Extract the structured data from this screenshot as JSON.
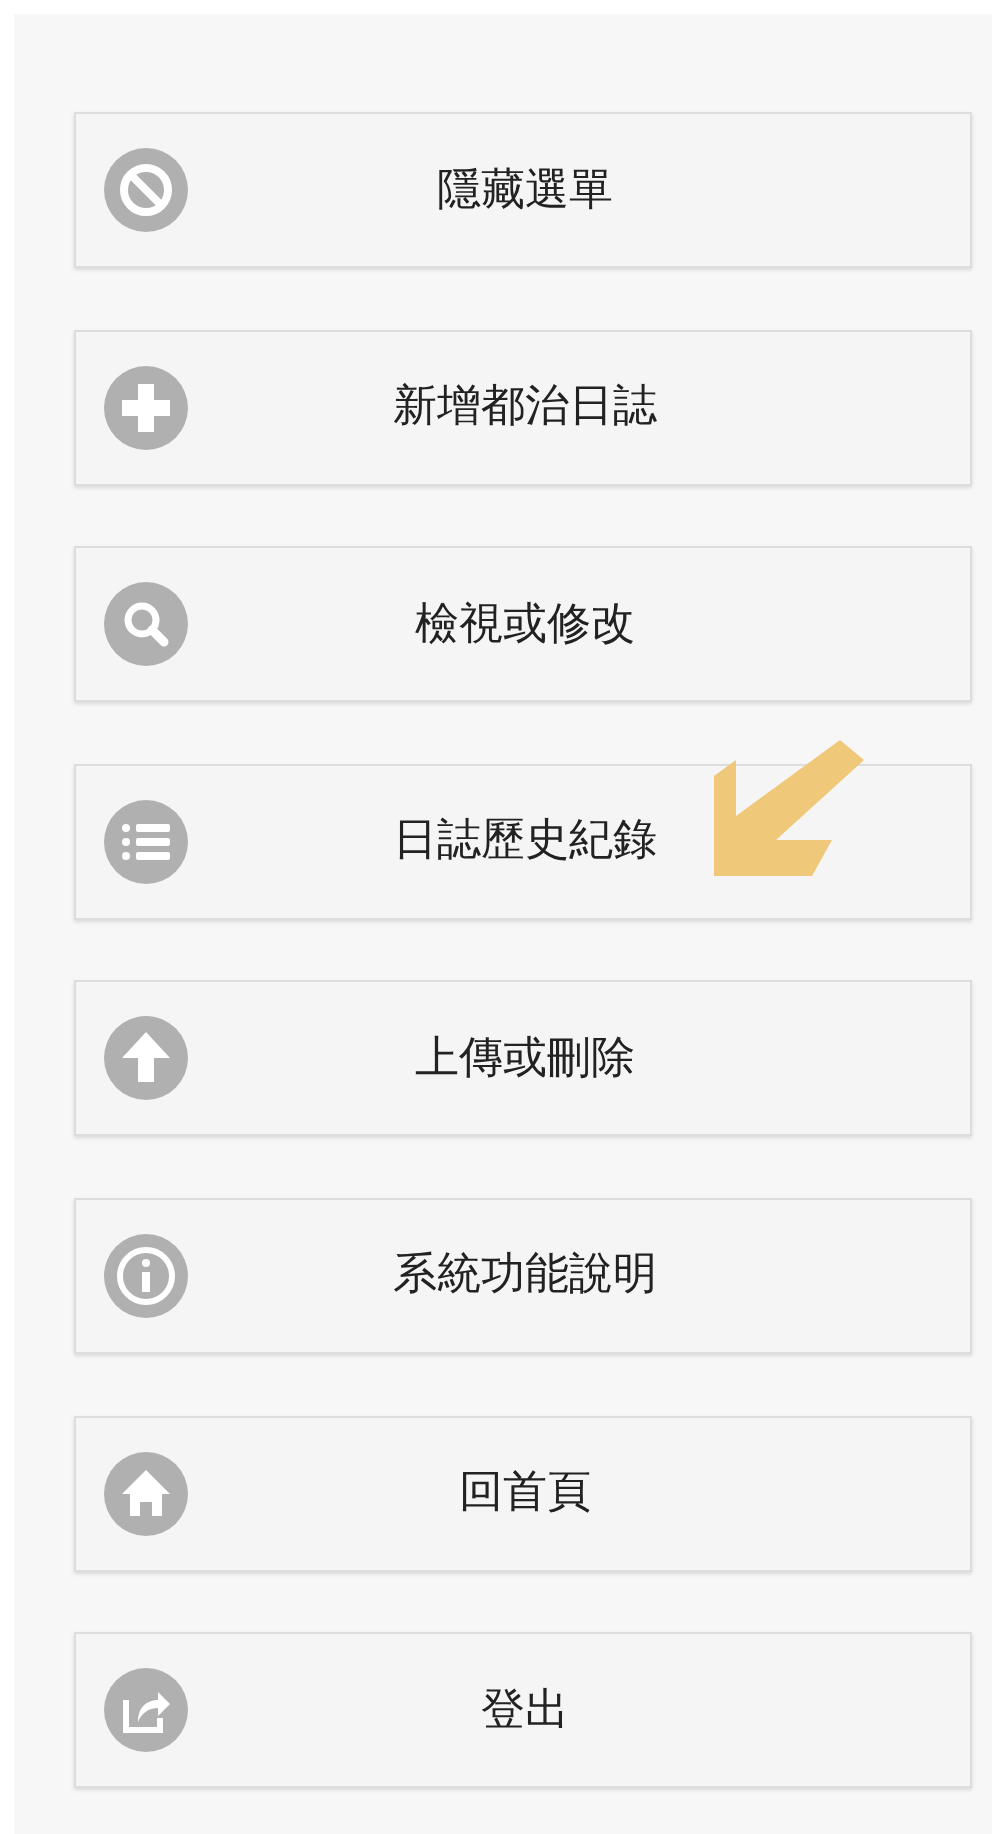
{
  "menu": [
    {
      "label": "隱藏選單",
      "pointed": false
    },
    {
      "label": "新增都治日誌",
      "pointed": false
    },
    {
      "label": "檢視或修改",
      "pointed": false
    },
    {
      "label": "日誌歷史紀錄",
      "pointed": true
    },
    {
      "label": "上傳或刪除",
      "pointed": false
    },
    {
      "label": "系統功能說明",
      "pointed": false
    },
    {
      "label": "回首頁",
      "pointed": false
    },
    {
      "label": "登出",
      "pointed": false
    }
  ]
}
